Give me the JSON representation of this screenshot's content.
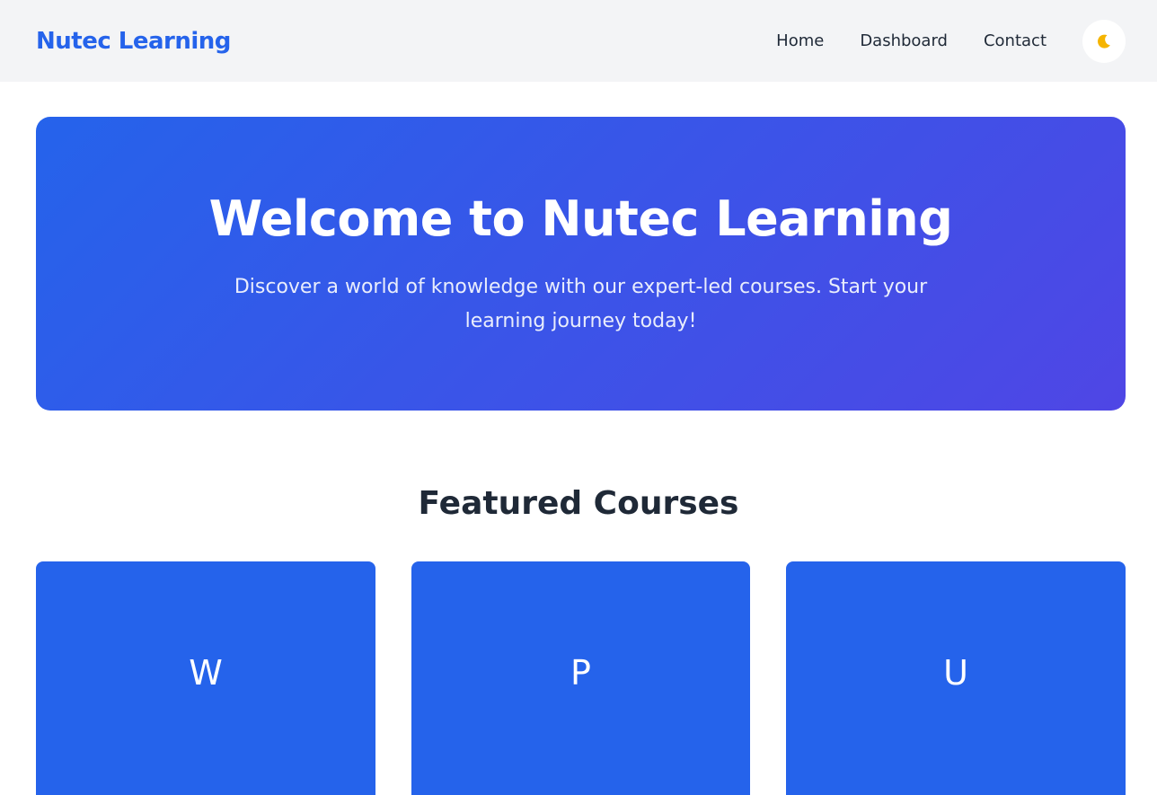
{
  "header": {
    "brand": "Nutec Learning",
    "nav": [
      {
        "label": "Home"
      },
      {
        "label": "Dashboard"
      },
      {
        "label": "Contact"
      }
    ],
    "theme_toggle_icon": "moon-icon"
  },
  "hero": {
    "title": "Welcome to Nutec Learning",
    "subtitle": "Discover a world of knowledge with our expert-led courses. Start your learning journey today!"
  },
  "featured": {
    "title": "Featured Courses",
    "cards": [
      {
        "letter": "W"
      },
      {
        "letter": "P"
      },
      {
        "letter": "U"
      }
    ]
  },
  "colors": {
    "accent": "#2563eb",
    "hero_gradient_end": "#4f46e5",
    "nav_background": "#f3f4f6",
    "text_dark": "#1f2937",
    "moon": "#f5b400"
  }
}
